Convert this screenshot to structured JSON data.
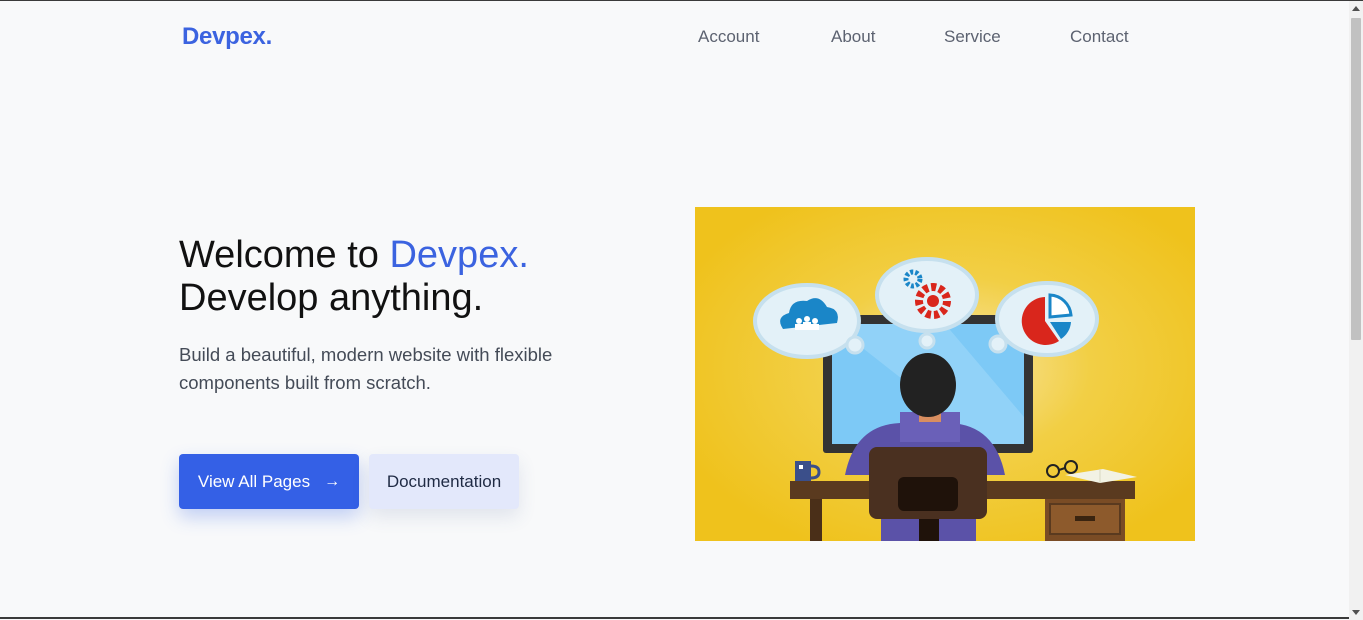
{
  "brand": {
    "name": "Devpex."
  },
  "nav": {
    "items": [
      {
        "label": "Account"
      },
      {
        "label": "About"
      },
      {
        "label": "Service"
      },
      {
        "label": "Contact"
      }
    ]
  },
  "hero": {
    "title_prefix": "Welcome to ",
    "title_accent": "Devpex.",
    "title_line2": "Develop anything.",
    "subtitle": "Build a beautiful, modern website with flexible components built from scratch.",
    "primary_button": "View All Pages",
    "primary_button_icon": "arrow-right-icon",
    "secondary_button": "Documentation"
  },
  "colors": {
    "accent": "#3b63e0",
    "primary_button": "#3460e6",
    "secondary_button": "#e3e8fb",
    "illustration_background": "#f0c419"
  }
}
